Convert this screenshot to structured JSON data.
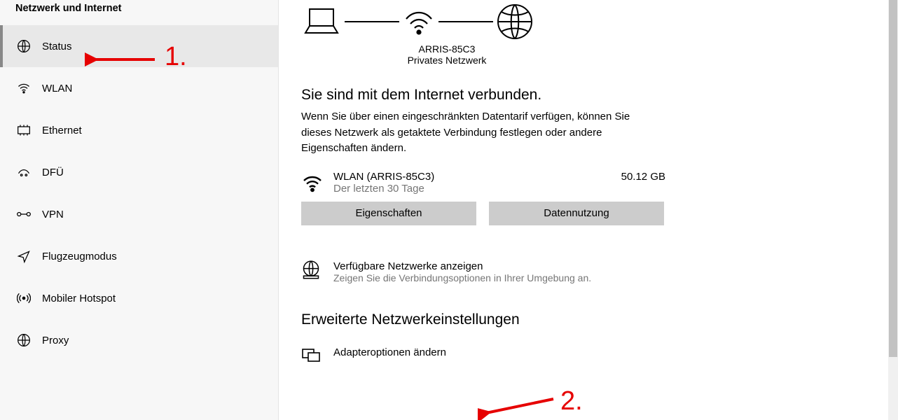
{
  "sidebar": {
    "title": "Netzwerk und Internet",
    "items": [
      {
        "label": "Status"
      },
      {
        "label": "WLAN"
      },
      {
        "label": "Ethernet"
      },
      {
        "label": "DFÜ"
      },
      {
        "label": "VPN"
      },
      {
        "label": "Flugzeugmodus"
      },
      {
        "label": "Mobiler Hotspot"
      },
      {
        "label": "Proxy"
      }
    ]
  },
  "diagram": {
    "ssid": "ARRIS-85C3",
    "net_type": "Privates Netzwerk"
  },
  "connected": {
    "heading": "Sie sind mit dem Internet verbunden.",
    "desc": "Wenn Sie über einen eingeschränkten Datentarif verfügen, können Sie dieses Netzwerk als getaktete Verbindung festlegen oder andere Eigenschaften ändern.",
    "name": "WLAN (ARRIS-85C3)",
    "sub": "Der letzten 30 Tage",
    "usage": "50.12 GB",
    "btn_props": "Eigenschaften",
    "btn_usage": "Datennutzung"
  },
  "available": {
    "title": "Verfügbare Netzwerke anzeigen",
    "sub": "Zeigen Sie die Verbindungsoptionen in Ihrer Umgebung an."
  },
  "advanced": {
    "heading": "Erweiterte Netzwerkeinstellungen",
    "adapter": "Adapteroptionen ändern"
  },
  "annotations": {
    "one": "1.",
    "two": "2."
  }
}
